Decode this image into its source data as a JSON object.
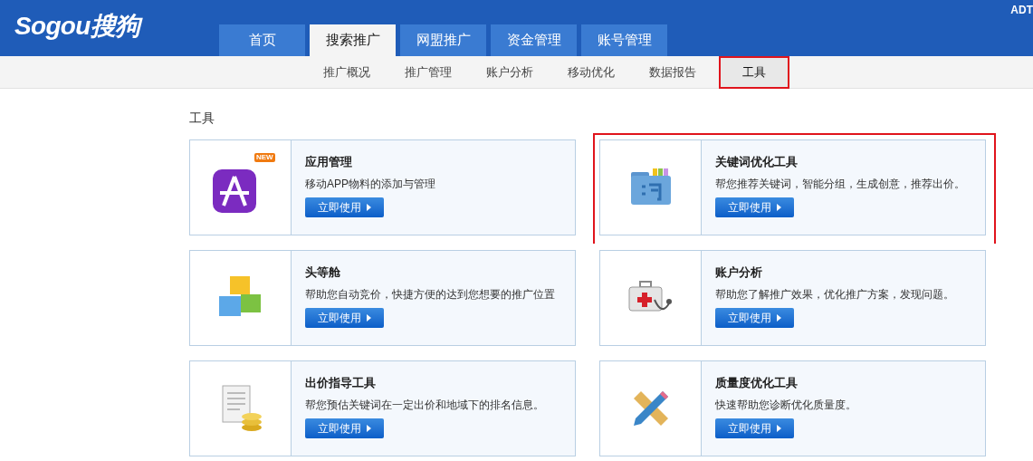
{
  "header": {
    "logo": "Sogou搜狗",
    "corner_text": "ADT"
  },
  "tabs": [
    {
      "label": "首页",
      "selected": false
    },
    {
      "label": "搜索推广",
      "selected": true
    },
    {
      "label": "网盟推广",
      "selected": false
    },
    {
      "label": "资金管理",
      "selected": false
    },
    {
      "label": "账号管理",
      "selected": false
    }
  ],
  "subnav": [
    {
      "label": "推广概况",
      "selected": false
    },
    {
      "label": "推广管理",
      "selected": false
    },
    {
      "label": "账户分析",
      "selected": false
    },
    {
      "label": "移动优化",
      "selected": false
    },
    {
      "label": "数据报告",
      "selected": false
    },
    {
      "label": "工具",
      "selected": true
    }
  ],
  "section_title": "工具",
  "tools": [
    {
      "kind": "app",
      "badge": "NEW",
      "title": "应用管理",
      "description": "移动APP物料的添加与管理",
      "button": "立即使用",
      "highlighted": false
    },
    {
      "kind": "keyword",
      "title": "关键词优化工具",
      "description": "帮您推荐关键词，智能分组，生成创意，推荐出价。",
      "button": "立即使用",
      "highlighted": true
    },
    {
      "kind": "blocks",
      "title": "头等舱",
      "description": "帮助您自动竞价，快捷方便的达到您想要的推广位置",
      "button": "立即使用",
      "highlighted": false
    },
    {
      "kind": "medkit",
      "title": "账户分析",
      "description": "帮助您了解推广效果，优化推广方案，发现问题。",
      "button": "立即使用",
      "highlighted": false
    },
    {
      "kind": "bid",
      "title": "出价指导工具",
      "description": "帮您预估关键词在一定出价和地域下的排名信息。",
      "button": "立即使用",
      "highlighted": false
    },
    {
      "kind": "quality",
      "title": "质量度优化工具",
      "description": "快速帮助您诊断优化质量度。",
      "button": "立即使用",
      "highlighted": false
    }
  ]
}
